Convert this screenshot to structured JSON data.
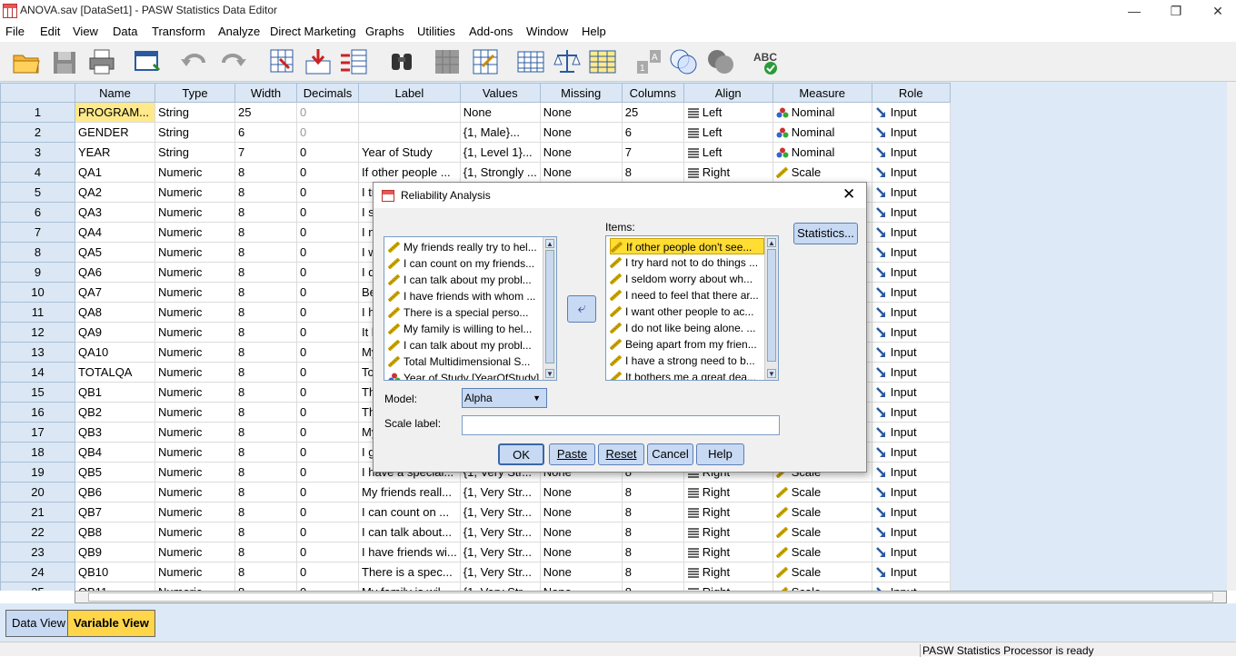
{
  "window": {
    "title": "ANOVA.sav [DataSet1] - PASW Statistics Data Editor"
  },
  "menu": [
    "File",
    "Edit",
    "View",
    "Data",
    "Transform",
    "Analyze",
    "Direct Marketing",
    "Graphs",
    "Utilities",
    "Add-ons",
    "Window",
    "Help"
  ],
  "columns": [
    "Name",
    "Type",
    "Width",
    "Decimals",
    "Label",
    "Values",
    "Missing",
    "Columns",
    "Align",
    "Measure",
    "Role"
  ],
  "rows": [
    [
      "1",
      "PROGRAM...",
      "String",
      "25",
      "0",
      "",
      "None",
      "None",
      "25",
      "Left",
      "Nominal",
      "Input"
    ],
    [
      "2",
      "GENDER",
      "String",
      "6",
      "0",
      "",
      "{1, Male}...",
      "None",
      "6",
      "Left",
      "Nominal",
      "Input"
    ],
    [
      "3",
      "YEAR",
      "String",
      "7",
      "0",
      "Year of Study",
      "{1, Level 1}...",
      "None",
      "7",
      "Left",
      "Nominal",
      "Input"
    ],
    [
      "4",
      "QA1",
      "Numeric",
      "8",
      "0",
      "If other people ...",
      "{1, Strongly ...",
      "None",
      "8",
      "Right",
      "Scale",
      "Input"
    ],
    [
      "5",
      "QA2",
      "Numeric",
      "8",
      "0",
      "I tr",
      "",
      "",
      "",
      "",
      "",
      "Input"
    ],
    [
      "6",
      "QA3",
      "Numeric",
      "8",
      "0",
      "I s",
      "",
      "",
      "",
      "",
      "",
      "Input"
    ],
    [
      "7",
      "QA4",
      "Numeric",
      "8",
      "0",
      "I n",
      "",
      "",
      "",
      "",
      "",
      "Input"
    ],
    [
      "8",
      "QA5",
      "Numeric",
      "8",
      "0",
      "I w",
      "",
      "",
      "",
      "",
      "",
      "Input"
    ],
    [
      "9",
      "QA6",
      "Numeric",
      "8",
      "0",
      "I d",
      "",
      "",
      "",
      "",
      "",
      "Input"
    ],
    [
      "10",
      "QA7",
      "Numeric",
      "8",
      "0",
      "Be",
      "",
      "",
      "",
      "",
      "",
      "Input"
    ],
    [
      "11",
      "QA8",
      "Numeric",
      "8",
      "0",
      "I h",
      "",
      "",
      "",
      "",
      "",
      "Input"
    ],
    [
      "12",
      "QA9",
      "Numeric",
      "8",
      "0",
      "It b",
      "",
      "",
      "",
      "",
      "",
      "Input"
    ],
    [
      "13",
      "QA10",
      "Numeric",
      "8",
      "0",
      "My",
      "",
      "",
      "",
      "",
      "",
      "Input"
    ],
    [
      "14",
      "TOTALQA",
      "Numeric",
      "8",
      "0",
      "To",
      "",
      "",
      "",
      "",
      "",
      "Input"
    ],
    [
      "15",
      "QB1",
      "Numeric",
      "8",
      "0",
      "Th",
      "",
      "",
      "",
      "",
      "",
      "Input"
    ],
    [
      "16",
      "QB2",
      "Numeric",
      "8",
      "0",
      "Th",
      "",
      "",
      "",
      "",
      "",
      "Input"
    ],
    [
      "17",
      "QB3",
      "Numeric",
      "8",
      "0",
      "My",
      "",
      "",
      "",
      "",
      "",
      "Input"
    ],
    [
      "18",
      "QB4",
      "Numeric",
      "8",
      "0",
      "I g",
      "",
      "",
      "",
      "",
      "",
      "Input"
    ],
    [
      "19",
      "QB5",
      "Numeric",
      "8",
      "0",
      "I have a special...",
      "{1, Very Str...",
      "None",
      "8",
      "Right",
      "Scale",
      "Input"
    ],
    [
      "20",
      "QB6",
      "Numeric",
      "8",
      "0",
      "My friends reall...",
      "{1, Very Str...",
      "None",
      "8",
      "Right",
      "Scale",
      "Input"
    ],
    [
      "21",
      "QB7",
      "Numeric",
      "8",
      "0",
      "I can count on ...",
      "{1, Very Str...",
      "None",
      "8",
      "Right",
      "Scale",
      "Input"
    ],
    [
      "22",
      "QB8",
      "Numeric",
      "8",
      "0",
      "I can talk about...",
      "{1, Very Str...",
      "None",
      "8",
      "Right",
      "Scale",
      "Input"
    ],
    [
      "23",
      "QB9",
      "Numeric",
      "8",
      "0",
      "I have friends wi...",
      "{1, Very Str...",
      "None",
      "8",
      "Right",
      "Scale",
      "Input"
    ],
    [
      "24",
      "QB10",
      "Numeric",
      "8",
      "0",
      "There is a spec...",
      "{1, Very Str...",
      "None",
      "8",
      "Right",
      "Scale",
      "Input"
    ],
    [
      "25",
      "QB11",
      "Numeric",
      "8",
      "0",
      "My family is wil...",
      "{1, Very Str...",
      "None",
      "8",
      "Right",
      "Scale",
      "Input"
    ]
  ],
  "tabs": {
    "data_view": "Data View",
    "variable_view": "Variable View"
  },
  "status": "PASW Statistics Processor is ready",
  "dialog": {
    "title": "Reliability Analysis",
    "source_items": [
      "My friends really try to hel...",
      "I can count on my friends...",
      "I can talk about my probl...",
      "I have friends with whom ...",
      "There is a special perso...",
      "My family is willing to hel...",
      "I can talk about my probl...",
      "Total Multidimensional S...",
      "Year of Study [YearOfStudy]"
    ],
    "items_label": "Items:",
    "items": [
      "If other people don't see...",
      "I try hard not to do things ...",
      "I seldom worry about wh...",
      "I need to feel that there ar...",
      "I want other people to ac...",
      "I do not like being alone. ...",
      "Being apart from my frien...",
      "I have a strong need to b...",
      "It bothers me a great dea..."
    ],
    "statistics_button": "Statistics...",
    "model_label": "Model:",
    "model_value": "Alpha",
    "scale_label": "Scale label:",
    "scale_value": "",
    "buttons": {
      "ok": "OK",
      "paste": "Paste",
      "reset": "Reset",
      "cancel": "Cancel",
      "help": "Help"
    }
  }
}
